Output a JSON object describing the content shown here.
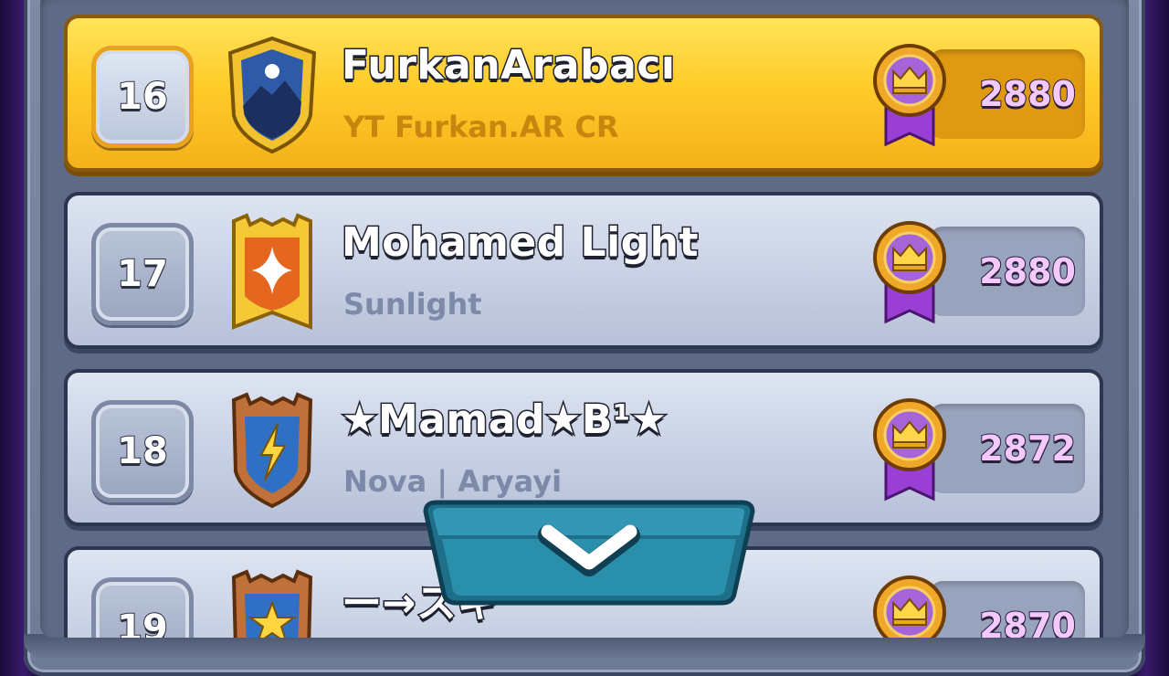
{
  "leaderboard": {
    "rows": [
      {
        "rank": "16",
        "name": "FurkanArabacı",
        "clan": "YT Furkan.AR CR",
        "trophies": "2880",
        "highlighted": true,
        "badge_icon": "mountain-badge-icon"
      },
      {
        "rank": "17",
        "name": "Mohamed Light",
        "clan": "Sunlight",
        "trophies": "2880",
        "highlighted": false,
        "badge_icon": "sparkle-badge-icon"
      },
      {
        "rank": "18",
        "name": "★Mamad★B¹★",
        "clan": "Nova | Aryayi",
        "trophies": "2872",
        "highlighted": false,
        "badge_icon": "lightning-badge-icon"
      },
      {
        "rank": "19",
        "name": "ー→スキ",
        "clan": "",
        "trophies": "2870",
        "highlighted": false,
        "badge_icon": "star-badge-icon"
      }
    ]
  },
  "scroll_button": {
    "icon": "chevron-down-icon"
  },
  "colors": {
    "highlight_row": "#ffcc2a",
    "normal_row": "#c7d0e3",
    "trophy_text": "#f4c9ff",
    "scroll_button": "#2a8fab"
  }
}
